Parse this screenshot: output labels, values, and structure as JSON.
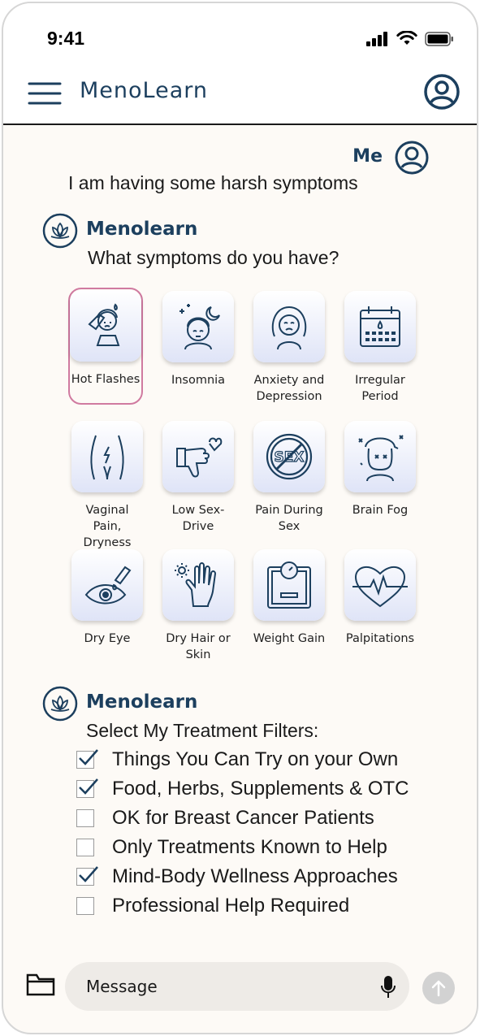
{
  "status_bar": {
    "time": "9:41"
  },
  "header": {
    "app_title": "MenoLearn",
    "menu_icon": "hamburger-icon",
    "profile_icon": "user-circle-icon"
  },
  "chat": {
    "user": {
      "name": "Me",
      "message": "I am having some harsh symptoms"
    },
    "bot1": {
      "name": "Menolearn",
      "message": "What symptoms do you have?"
    },
    "symptoms": [
      {
        "label": "Hot Flashes",
        "icon": "hot-flashes-icon",
        "selected": true
      },
      {
        "label": "Insomnia",
        "icon": "insomnia-icon",
        "selected": false
      },
      {
        "label": "Anxiety and Depression",
        "icon": "anxiety-icon",
        "selected": false
      },
      {
        "label": "Irregular Period",
        "icon": "calendar-icon",
        "selected": false
      },
      {
        "label": "Vaginal Pain, Dryness",
        "icon": "vaginal-pain-icon",
        "selected": false
      },
      {
        "label": "Low Sex-Drive",
        "icon": "thumbs-down-heart-icon",
        "selected": false
      },
      {
        "label": "Pain During Sex",
        "icon": "no-sex-icon",
        "selected": false
      },
      {
        "label": "Brain Fog",
        "icon": "brain-fog-icon",
        "selected": false
      },
      {
        "label": "Dry Eye",
        "icon": "eye-drop-icon",
        "selected": false
      },
      {
        "label": "Dry Hair or Skin",
        "icon": "hand-sun-icon",
        "selected": false
      },
      {
        "label": "Weight Gain",
        "icon": "scale-icon",
        "selected": false
      },
      {
        "label": "Palpitations",
        "icon": "heartbeat-icon",
        "selected": false
      }
    ],
    "bot2": {
      "name": "Menolearn",
      "message": "Select My Treatment Filters:"
    },
    "filters": [
      {
        "label": "Things You Can Try on your Own",
        "checked": true
      },
      {
        "label": "Food, Herbs, Supplements & OTC",
        "checked": true
      },
      {
        "label": "OK for Breast Cancer Patients",
        "checked": false
      },
      {
        "label": "Only Treatments Known to Help",
        "checked": false
      },
      {
        "label": "Mind-Body Wellness Approaches",
        "checked": true
      },
      {
        "label": "Professional Help Required",
        "checked": false
      }
    ]
  },
  "composer": {
    "placeholder": "Message",
    "folder_icon": "folder-icon",
    "mic_icon": "microphone-icon",
    "send_icon": "arrow-up-icon"
  },
  "colors": {
    "brand": "#1c3f5e",
    "selected_border": "#d07aa0",
    "background": "#fdfaf6"
  }
}
